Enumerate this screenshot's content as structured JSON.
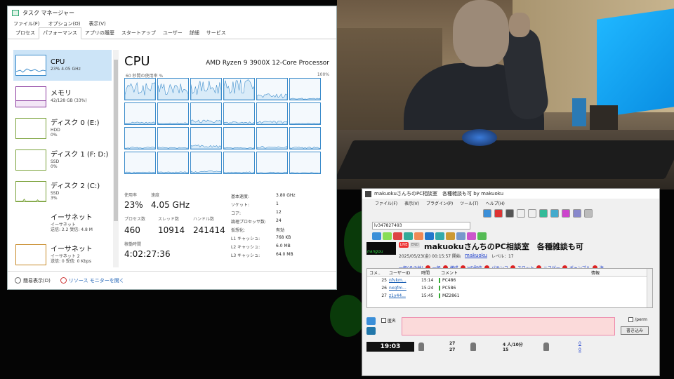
{
  "taskmgr": {
    "title": "タスク マネージャー",
    "menu": [
      "ファイル(F)",
      "オプション(O)",
      "表示(V)"
    ],
    "tabs": [
      "プロセス",
      "パフォーマンス",
      "アプリの履歴",
      "スタートアップ",
      "ユーザー",
      "詳細",
      "サービス"
    ],
    "active_tab": "パフォーマンス",
    "sidebar": [
      {
        "name": "CPU",
        "sub1": "23%  4.05 GHz",
        "sub2": ""
      },
      {
        "name": "メモリ",
        "sub1": "42/128 GB (33%)",
        "sub2": ""
      },
      {
        "name": "ディスク 0 (E:)",
        "sub1": "HDD",
        "sub2": "0%"
      },
      {
        "name": "ディスク 1 (F: D:)",
        "sub1": "SSD",
        "sub2": "0%"
      },
      {
        "name": "ディスク 2 (C:)",
        "sub1": "SSD",
        "sub2": "3%"
      },
      {
        "name": "イーサネット",
        "sub1": "イーサネット",
        "sub2": "送信: 2.2  受信: 4.8 M"
      },
      {
        "name": "イーサネット",
        "sub1": "イーサネット 2",
        "sub2": "送信: 0  受信: 0 Kbps"
      }
    ],
    "cpu": {
      "title": "CPU",
      "model": "AMD Ryzen 9 3900X 12-Core Processor",
      "util_label": "60 秒間の使用率 %",
      "util_max": "100%",
      "labels": {
        "usage": "使用率",
        "speed": "速度",
        "processes": "プロセス数",
        "threads": "スレッド数",
        "handles": "ハンドル数",
        "uptime": "稼働時間"
      },
      "values": {
        "usage": "23%",
        "speed": "4.05 GHz",
        "processes": "460",
        "threads": "10914",
        "handles": "241414",
        "uptime": "4:02:27:36"
      },
      "details": [
        {
          "k": "基本速度:",
          "v": "3.80 GHz"
        },
        {
          "k": "ソケット:",
          "v": "1"
        },
        {
          "k": "コア:",
          "v": "12"
        },
        {
          "k": "論理プロセッサ数:",
          "v": "24"
        },
        {
          "k": "仮想化:",
          "v": "有効"
        },
        {
          "k": "L1 キャッシュ:",
          "v": "768 KB"
        },
        {
          "k": "L2 キャッシュ:",
          "v": "6.0 MB"
        },
        {
          "k": "L3 キャッシュ:",
          "v": "64.0 MB"
        }
      ],
      "core_levels": [
        0.55,
        0.5,
        0.6,
        0.65,
        0.2,
        0.05,
        0.08,
        0.05,
        0.15,
        0.08,
        0.1,
        0.04,
        0.06,
        0.05,
        0.12,
        0.04,
        0.08,
        0.06,
        0.05,
        0.05,
        0.08,
        0.05,
        0.04,
        0.03
      ]
    },
    "footer": {
      "brief": "簡易表示(D)",
      "monitor": "リソース モニターを開く"
    }
  },
  "nicolive": {
    "title": "makuokuさんちのPC相談室　各種雑談も可 by makuoku",
    "menu": [
      "ファイル(F)",
      "表示(V)",
      "プラグイン(P)",
      "ツール(T)",
      "ヘルプ(H)"
    ],
    "lv": "lv347827493",
    "logo": "nangou",
    "live": "LIVE",
    "end": "END",
    "room_title": "makuokuさんちのPC相談室　各種雑談も可",
    "date": "2025/05/23(金) 00:15:57 開始",
    "user": "makuoku",
    "level": "レベル：17",
    "categories": [
      "一般(その他)",
      "一般",
      "構成",
      "HD配信",
      "パチンコ",
      "スロット",
      "ニコゲー",
      "ギャンブル",
      "海"
    ],
    "columns": [
      "コメ..",
      "ユーザーID",
      "時間",
      "コメント",
      "",
      "情報"
    ],
    "rows": [
      {
        "no": "25",
        "id": "nfvkm...",
        "time": "15:14",
        "comment": "PC486"
      },
      {
        "no": "26",
        "id": "nxgfm...",
        "time": "15:24",
        "comment": "PC586"
      },
      {
        "no": "27",
        "id": "z1y44...",
        "time": "15:45",
        "comment": "MZ2861"
      }
    ],
    "input": {
      "anon": "匿名",
      "perm": "/perm",
      "submit": "書き込み"
    },
    "status": {
      "clock": "19:03",
      "c1a": "27",
      "c1b": "27",
      "c2a": "4 人/10分",
      "c2b": "15",
      "c3a": "0",
      "c3b": "0"
    }
  }
}
